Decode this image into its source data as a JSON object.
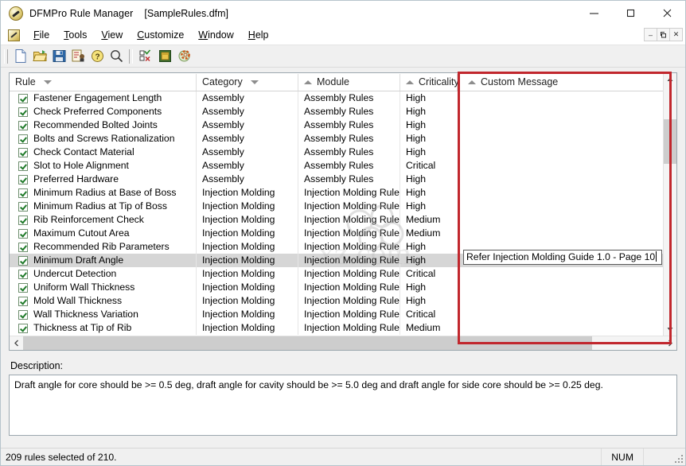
{
  "window": {
    "title": "DFMPro Rule Manager",
    "document": "[SampleRules.dfm]",
    "minimize": "—",
    "maximize": "☐",
    "close": "✕"
  },
  "mdi_buttons": {
    "minimize": "–",
    "restore": "❐",
    "close": "✕"
  },
  "menu": {
    "items": [
      {
        "label": "File",
        "accel": "F"
      },
      {
        "label": "Tools",
        "accel": "T"
      },
      {
        "label": "View",
        "accel": "V"
      },
      {
        "label": "Customize",
        "accel": "C"
      },
      {
        "label": "Window",
        "accel": "W"
      },
      {
        "label": "Help",
        "accel": "H"
      }
    ]
  },
  "toolbar": {
    "buttons": [
      {
        "name": "new-icon",
        "tooltip": "New"
      },
      {
        "name": "open-folder-icon",
        "tooltip": "Open"
      },
      {
        "name": "save-floppy-icon",
        "tooltip": "Save"
      },
      {
        "name": "validate-rules-icon",
        "tooltip": "Validate Rules"
      },
      {
        "name": "help-question-icon",
        "tooltip": "Help"
      },
      {
        "name": "search-magnifier-icon",
        "tooltip": "Find"
      },
      {
        "name": "rule-checklist-icon",
        "tooltip": "Rule Set"
      },
      {
        "name": "database-icon",
        "tooltip": "Database"
      },
      {
        "name": "settings-gear-icon",
        "tooltip": "Settings"
      }
    ]
  },
  "grid": {
    "columns": [
      {
        "key": "rule",
        "label": "Rule",
        "sort": "down"
      },
      {
        "key": "category",
        "label": "Category",
        "sort": "down"
      },
      {
        "key": "module",
        "label": "Module",
        "sort": "up"
      },
      {
        "key": "criticality",
        "label": "Criticality",
        "sort": "up"
      },
      {
        "key": "custom_message",
        "label": "Custom Message",
        "sort": "up"
      }
    ],
    "rows": [
      {
        "checked": true,
        "rule": "Fastener Engagement Length",
        "category": "Assembly",
        "module": "Assembly Rules",
        "criticality": "High",
        "custom_message": "",
        "selected": false
      },
      {
        "checked": true,
        "rule": "Check Preferred Components",
        "category": "Assembly",
        "module": "Assembly Rules",
        "criticality": "High",
        "custom_message": "",
        "selected": false
      },
      {
        "checked": true,
        "rule": "Recommended Bolted Joints",
        "category": "Assembly",
        "module": "Assembly Rules",
        "criticality": "High",
        "custom_message": "",
        "selected": false
      },
      {
        "checked": true,
        "rule": "Bolts and Screws Rationalization",
        "category": "Assembly",
        "module": "Assembly Rules",
        "criticality": "High",
        "custom_message": "",
        "selected": false
      },
      {
        "checked": true,
        "rule": "Check Contact Material",
        "category": "Assembly",
        "module": "Assembly Rules",
        "criticality": "High",
        "custom_message": "",
        "selected": false
      },
      {
        "checked": true,
        "rule": "Slot to Hole Alignment",
        "category": "Assembly",
        "module": "Assembly Rules",
        "criticality": "Critical",
        "custom_message": "",
        "selected": false
      },
      {
        "checked": true,
        "rule": "Preferred Hardware",
        "category": "Assembly",
        "module": "Assembly Rules",
        "criticality": "High",
        "custom_message": "",
        "selected": false
      },
      {
        "checked": true,
        "rule": "Minimum Radius at Base of Boss",
        "category": "Injection Molding",
        "module": "Injection Molding Rules",
        "criticality": "High",
        "custom_message": "",
        "selected": false
      },
      {
        "checked": true,
        "rule": "Minimum Radius at Tip of Boss",
        "category": "Injection Molding",
        "module": "Injection Molding Rules",
        "criticality": "High",
        "custom_message": "",
        "selected": false
      },
      {
        "checked": true,
        "rule": "Rib Reinforcement Check",
        "category": "Injection Molding",
        "module": "Injection Molding Rules",
        "criticality": "Medium",
        "custom_message": "",
        "selected": false
      },
      {
        "checked": true,
        "rule": "Maximum Cutout Area",
        "category": "Injection Molding",
        "module": "Injection Molding Rules",
        "criticality": "Medium",
        "custom_message": "",
        "selected": false
      },
      {
        "checked": true,
        "rule": "Recommended Rib Parameters",
        "category": "Injection Molding",
        "module": "Injection Molding Rules",
        "criticality": "High",
        "custom_message": "",
        "selected": false
      },
      {
        "checked": true,
        "rule": "Minimum Draft Angle",
        "category": "Injection Molding",
        "module": "Injection Molding Rules",
        "criticality": "High",
        "custom_message": "",
        "selected": true
      },
      {
        "checked": true,
        "rule": "Undercut Detection",
        "category": "Injection Molding",
        "module": "Injection Molding Rules",
        "criticality": "Critical",
        "custom_message": "",
        "selected": false
      },
      {
        "checked": true,
        "rule": "Uniform Wall Thickness",
        "category": "Injection Molding",
        "module": "Injection Molding Rules",
        "criticality": "High",
        "custom_message": "",
        "selected": false
      },
      {
        "checked": true,
        "rule": "Mold Wall Thickness",
        "category": "Injection Molding",
        "module": "Injection Molding Rules",
        "criticality": "High",
        "custom_message": "",
        "selected": false
      },
      {
        "checked": true,
        "rule": "Wall Thickness Variation",
        "category": "Injection Molding",
        "module": "Injection Molding Rules",
        "criticality": "Critical",
        "custom_message": "",
        "selected": false
      },
      {
        "checked": true,
        "rule": "Thickness at Tip of Rib",
        "category": "Injection Molding",
        "module": "Injection Molding Rules",
        "criticality": "Medium",
        "custom_message": "",
        "selected": false
      }
    ]
  },
  "custom_message_editor": {
    "value": "Refer Injection Molding Guide 1.0 - Page 10"
  },
  "description": {
    "label": "Description:",
    "text": "Draft angle for core should be >= 0.5 deg, draft angle for cavity should be >= 5.0 deg and draft angle for side core should be >= 0.25 deg."
  },
  "statusbar": {
    "message": "209 rules selected of 210.",
    "num_indicator": "NUM"
  },
  "colors": {
    "annotation_red": "#c1272d",
    "selection_gray": "#d6d6d6",
    "window_chrome": "#f0f0f0"
  }
}
